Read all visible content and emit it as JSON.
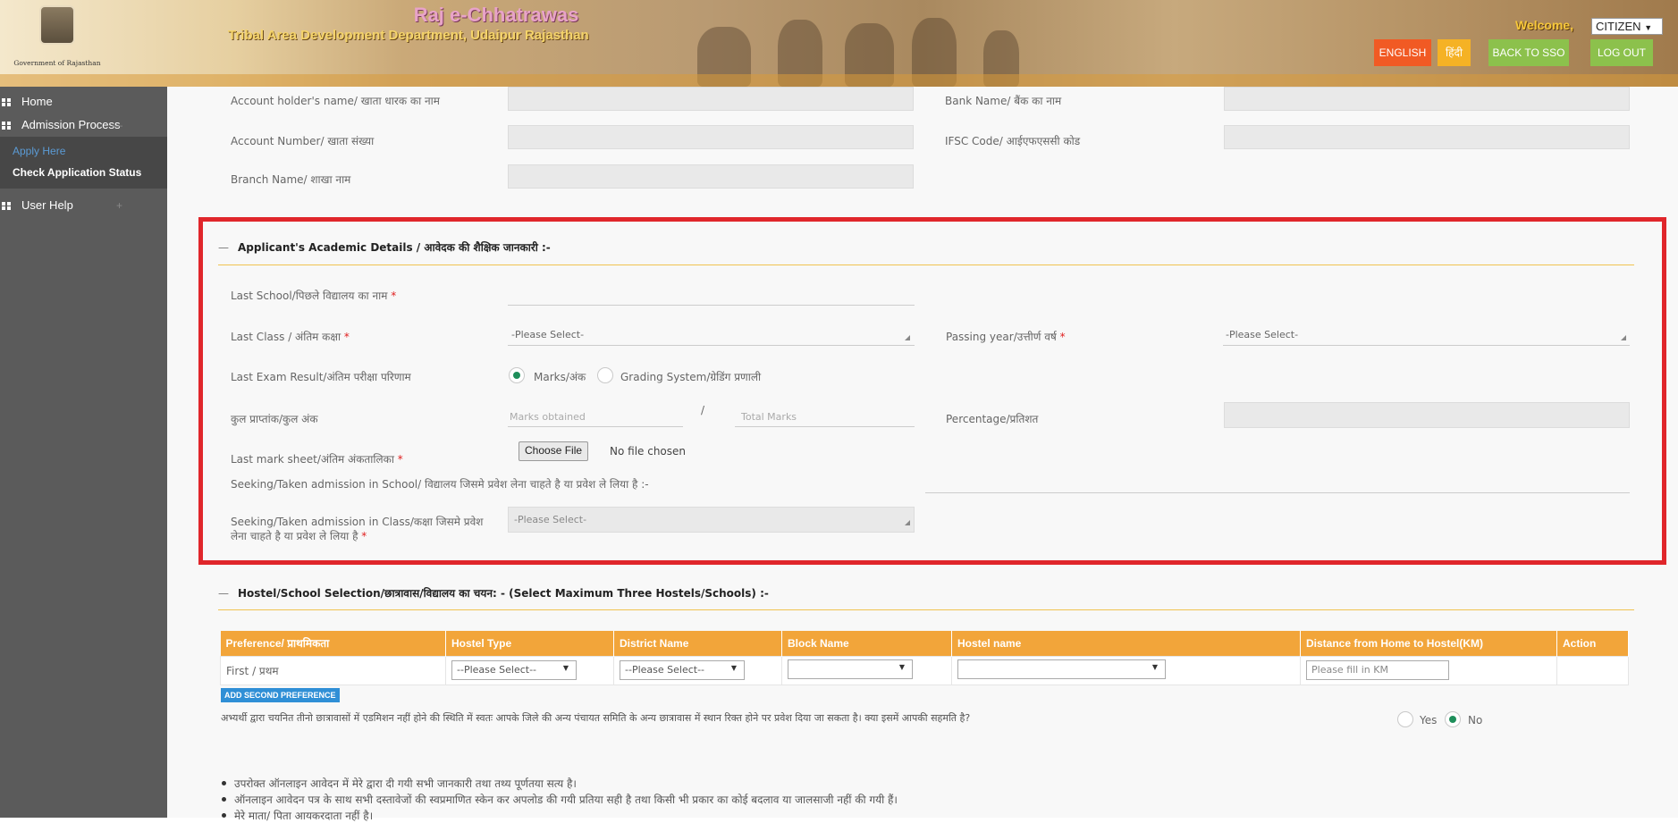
{
  "header": {
    "emblem_caption": "Government of Rajasthan",
    "title": "Raj e-Chhatrawas",
    "subtitle": "Tribal Area Development Department, Udaipur Rajasthan",
    "welcome": "Welcome,",
    "user": "CITIZEN",
    "buttons": {
      "english": "ENGLISH",
      "hindi": "हिंदी",
      "back_to_sso": "BACK TO SSO",
      "logout": "LOG OUT"
    }
  },
  "sidebar": {
    "home": "Home",
    "admission": "Admission Process",
    "admission_toggle": "—",
    "apply_here": "Apply Here",
    "check_status": "Check Application Status",
    "user_help": "User Help",
    "user_help_toggle": "+"
  },
  "bank": {
    "account_holder": "Account holder's name/ खाता धारक का नाम",
    "bank_name": "Bank Name/ बैंक का नाम",
    "account_number": "Account Number/ खाता संख्या",
    "ifsc": "IFSC Code/ आईएफएससी कोड",
    "branch": "Branch Name/ शाखा नाम"
  },
  "academic": {
    "title": "Applicant's Academic Details / आवेदक की शैक्षिक जानकारी :-",
    "dash": "—",
    "last_school": "Last School/पिछले विद्यालय का नाम",
    "last_class": "Last Class / अंतिम कक्षा",
    "last_class_value": "-Please Select-",
    "passing_year": "Passing year/उत्तीर्ण वर्ष",
    "passing_year_value": "-Please Select-",
    "result": "Last Exam Result/अंतिम परीक्षा परिणाम",
    "marks_option": "Marks/अंक",
    "grading_option": "Grading System/ग्रेडिंग प्रणाली",
    "total_marks_label": "कुल प्राप्तांक/कुल अंक",
    "marks_obtained_ph": "Marks obtained",
    "slash": "/",
    "total_marks_ph": "Total Marks",
    "percentage": "Percentage/प्रतिशत",
    "mark_sheet": "Last mark sheet/अंतिम अंकतालिका",
    "choose_file": "Choose File",
    "no_file": "No file chosen",
    "seeking_school": "Seeking/Taken admission in School/ विद्यालय जिसमे प्रवेश लेना चाहते है या प्रवेश ले लिया है :-",
    "seeking_class_1": "Seeking/Taken admission in Class/कक्षा जिसमे प्रवेश",
    "seeking_class_2": "लेना चाहते है या प्रवेश ले लिया है",
    "seeking_class_value": "-Please Select-",
    "required_mark": "*"
  },
  "hostel": {
    "title": "Hostel/School Selection/छात्रावास/विद्यालय का चयन: - (Select Maximum Three Hostels/Schools) :-",
    "dash": "—",
    "columns": [
      "Preference/ प्राथमिकता",
      "Hostel Type",
      "District Name",
      "Block Name",
      "Hostel name",
      "Distance from Home to Hostel(KM)",
      "Action"
    ],
    "row": {
      "preference": "First / प्रथम",
      "hostel_type": "--Please Select--",
      "district": "--Please Select--",
      "block": "",
      "hostel": "",
      "distance_ph": "Please fill in KM"
    },
    "add_second": "ADD SECOND PREFERENCE",
    "consent_q": "अभ्यर्थी द्वारा चयनित तीनो छात्रावासों में एडमिशन नहीं होने की स्थिति में स्वतः आपके जिले की अन्य पंचायत समिति के अन्य छात्रावास में स्थान रिक्त होने पर प्रवेश दिया जा सकता है। क्या इसमें आपकी सहमति है?",
    "yes": "Yes",
    "no": "No"
  },
  "declarations": [
    "उपरोक्त ऑनलाइन आवेदन में मेरे द्वारा दी गयी सभी जानकारी तथा तथ्य पूर्णतया सत्य है।",
    "ऑनलाइन आवेदन पत्र के साथ सभी दस्तावेजों की स्वप्रमाणित स्केन कर अपलोड की गयी प्रतिया सही है तथा किसी भी प्रकार का कोई बदलाव या जालसाजी नहीं की गयी हैं।",
    "मेरे माता/ पिता आयकरदाता नहीं है।"
  ]
}
